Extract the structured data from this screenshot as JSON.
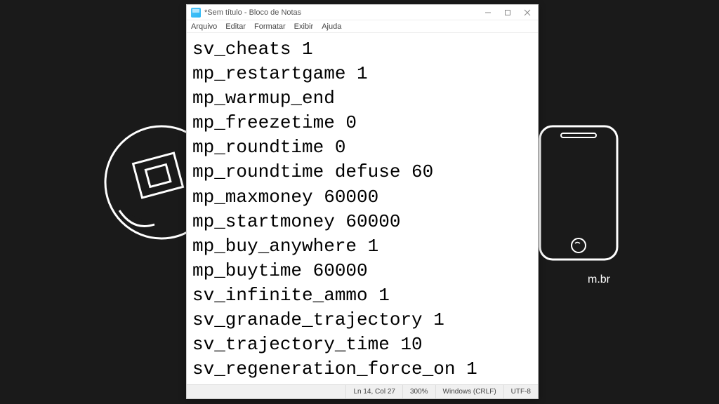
{
  "window": {
    "title": "*Sem título - Bloco de Notas"
  },
  "menu": {
    "file": "Arquivo",
    "edit": "Editar",
    "format": "Formatar",
    "view": "Exibir",
    "help": "Ajuda"
  },
  "content": "sv_cheats 1\nmp_restartgame 1\nmp_warmup_end\nmp_freezetime 0\nmp_roundtime 0\nmp_roundtime defuse 60\nmp_maxmoney 60000\nmp_startmoney 60000\nmp_buy_anywhere 1\nmp_buytime 60000\nsv_infinite_ammo 1\nsv_granade_trajectory 1\nsv_trajectory_time 10\nsv_regeneration_force_on 1",
  "statusbar": {
    "position": "Ln 14, Col 27",
    "zoom": "300%",
    "line_ending": "Windows (CRLF)",
    "encoding": "UTF-8"
  },
  "background": {
    "domain_text": "m.br"
  }
}
